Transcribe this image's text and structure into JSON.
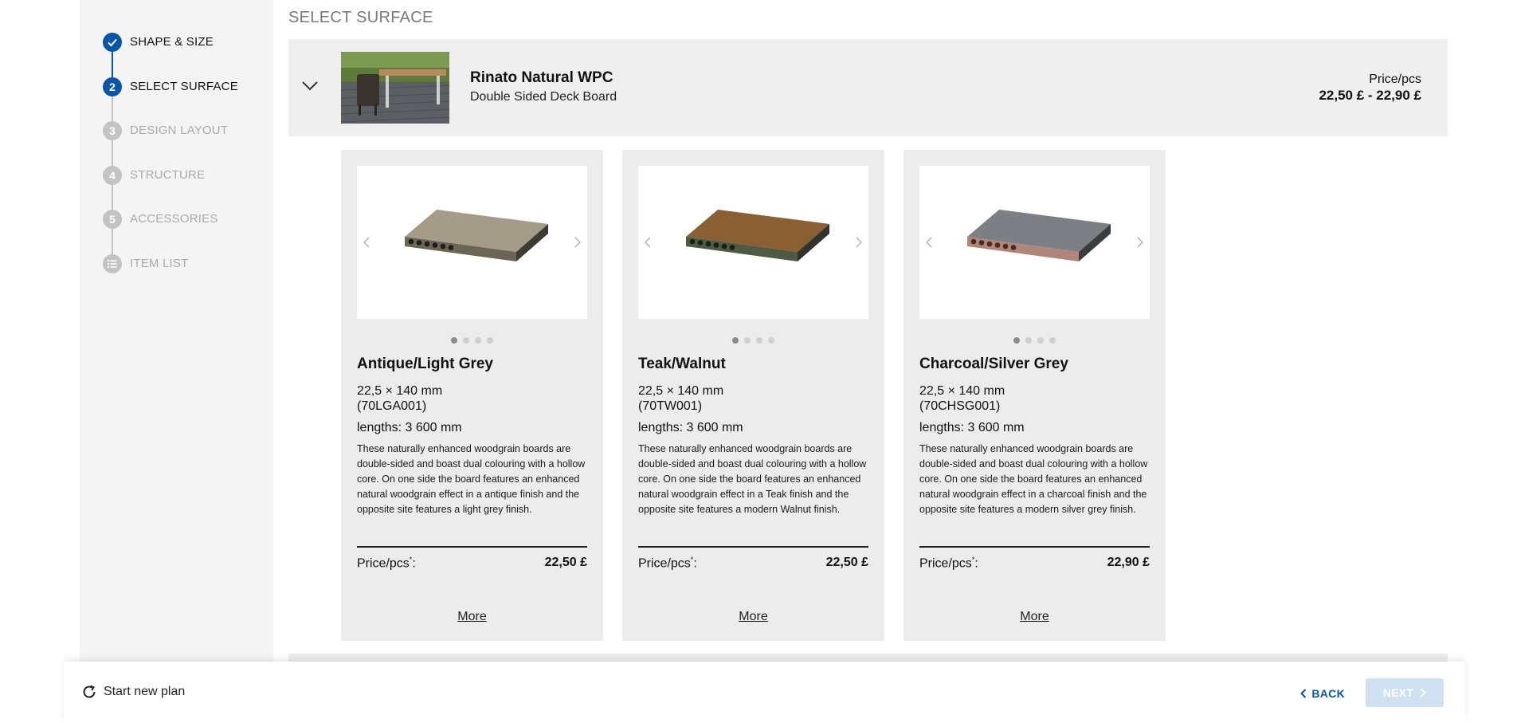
{
  "sidebar": {
    "steps": [
      {
        "number": "✓",
        "label": "SHAPE & SIZE",
        "state": "done"
      },
      {
        "number": "2",
        "label": "SELECT SURFACE",
        "state": "active"
      },
      {
        "number": "3",
        "label": "DESIGN LAYOUT",
        "state": "todo"
      },
      {
        "number": "4",
        "label": "STRUCTURE",
        "state": "todo"
      },
      {
        "number": "5",
        "label": "ACCESSORIES",
        "state": "todo"
      },
      {
        "number": "list-icon",
        "label": "ITEM LIST",
        "state": "todo"
      }
    ]
  },
  "main": {
    "section_title": "SELECT SURFACE",
    "product": {
      "name": "Rinato Natural WPC",
      "subtitle": "Double Sided Deck Board",
      "price_label": "Price/pcs",
      "price_range": "22,50 £ - 22,90 £"
    },
    "cards": [
      {
        "title": "Antique/Light Grey",
        "dimensions": "22,5 × 140 mm",
        "code": "(70LGA001)",
        "lengths": "lengths: 3 600 mm",
        "description": "These naturally enhanced woodgrain boards are double-sided and boast dual colouring with a hollow core. On one side the board features an enhanced natural woodgrain effect in a antique finish and the opposite site features a light grey finish.",
        "price_label": "Price/pcs",
        "price_sup": "*",
        "price_suffix": ":",
        "price": "22,50 £",
        "more": "More",
        "board_top": "#a49c89",
        "board_front": "#6b6556"
      },
      {
        "title": "Teak/Walnut",
        "dimensions": "22,5 × 140 mm",
        "code": "(70TW001)",
        "lengths": "lengths: 3 600 mm",
        "description": "These naturally enhanced woodgrain boards are double-sided and boast dual colouring with a hollow core. On one side the board features an enhanced natural woodgrain effect in a Teak finish and the opposite site features a modern Walnut finish.",
        "price_label": "Price/pcs",
        "price_sup": "*",
        "price_suffix": ":",
        "price": "22,50 £",
        "more": "More",
        "board_top": "#8a5f31",
        "board_front": "#4e5a44"
      },
      {
        "title": "Charcoal/Silver Grey",
        "dimensions": "22,5 × 140 mm",
        "code": "(70CHSG001)",
        "lengths": "lengths: 3 600 mm",
        "description": "These naturally enhanced woodgrain boards are double-sided and boast dual colouring with a hollow core. On one side the board features an enhanced natural woodgrain effect in a charcoal finish and the opposite site features a modern silver grey finish.",
        "price_label": "Price/pcs",
        "price_sup": "*",
        "price_suffix": ":",
        "price": "22,90 £",
        "more": "More",
        "board_top": "#7c7f84",
        "board_front": "#b0857a"
      }
    ]
  },
  "footer": {
    "start_new": "Start new plan",
    "back": "BACK",
    "next": "NEXT"
  },
  "colors": {
    "accent": "#0a55a5",
    "step_todo": "#c3c3c3",
    "next_disabled": "#cfe1f1"
  }
}
